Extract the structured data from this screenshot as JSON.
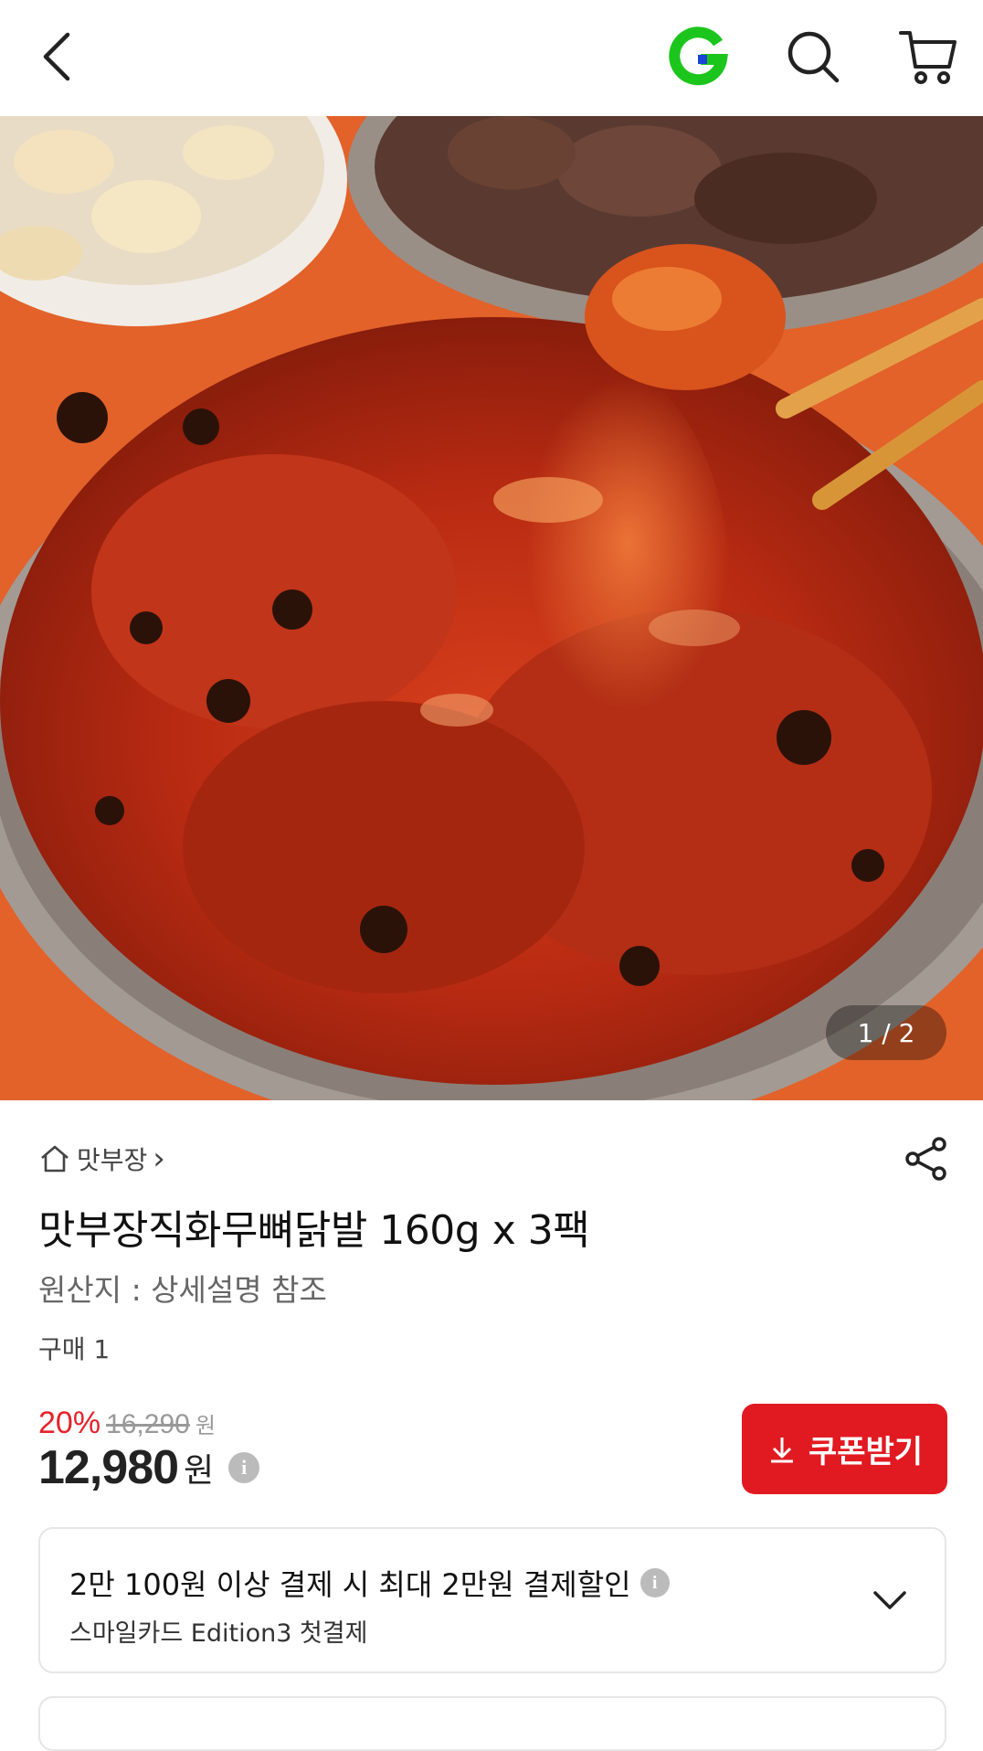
{
  "header": {
    "back_icon": "chevron-left-icon",
    "brand_icon": "gmarket-g-logo",
    "search_icon": "search-icon",
    "cart_icon": "cart-icon"
  },
  "hero": {
    "description_icon": "product-photo-spicy-chicken-feet",
    "pager": "1 / 2"
  },
  "product": {
    "store_name": "맛부장",
    "store_chevron": "›",
    "title": "맛부장직화무뼈닭발 160g x 3팩",
    "origin": "원산지 : 상세설명 참조",
    "purchase_count": "구매 1",
    "discount_rate": "20%",
    "original_price": "16,290",
    "original_unit": "원",
    "price": "12,980",
    "price_unit": "원",
    "info_glyph": "i"
  },
  "coupon": {
    "label": "쿠폰받기",
    "color": "#e11a22"
  },
  "promo": {
    "line1": "2만 100원 이상 결제 시 최대 2만원 결제할인",
    "line2": "스마일카드 Edition3 첫결제"
  },
  "colors": {
    "accent_red": "#e5222a",
    "brand_green": "#1cc51c",
    "brand_blue": "#1a44d6"
  }
}
